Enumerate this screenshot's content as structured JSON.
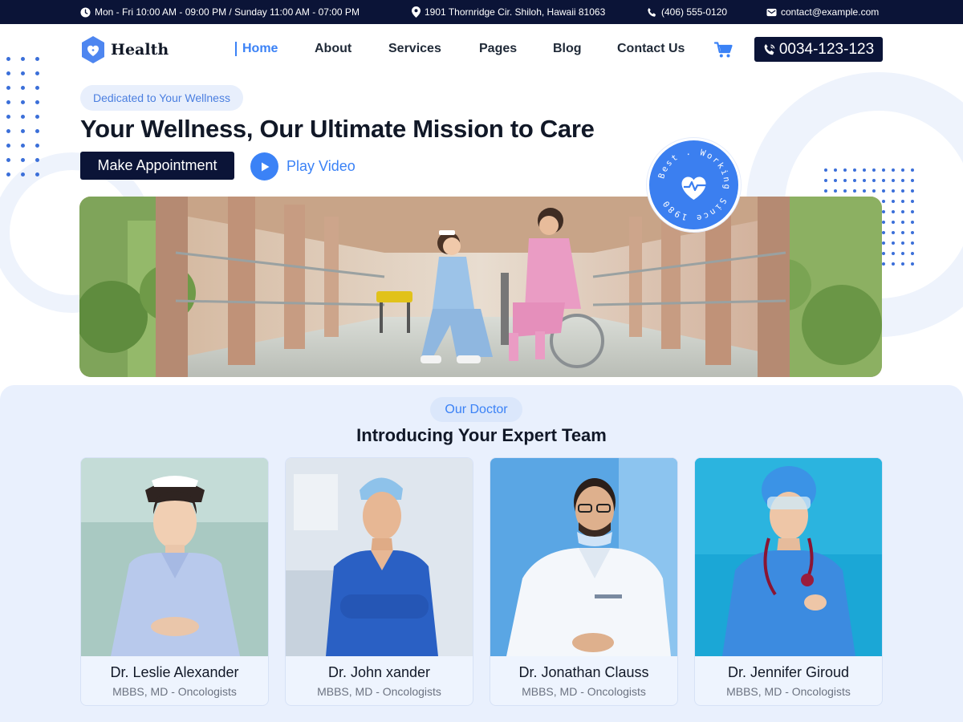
{
  "topbar": {
    "hours": "Mon - Fri 10:00 AM - 09:00 PM / Sunday 11:00 AM - 07:00 PM",
    "address": "1901 Thornridge Cir. Shiloh, Hawaii 81063",
    "phone": "(406) 555-0120",
    "email": "contact@example.com"
  },
  "header": {
    "logo_text": "Health",
    "nav": [
      "Home",
      "About",
      "Services",
      "Pages",
      "Blog",
      "Contact Us"
    ],
    "active_nav": "Home",
    "phone_button": "0034-123-123"
  },
  "hero": {
    "tagline": "Dedicated to Your Wellness",
    "title": "Your Wellness, Our Ultimate Mission to Care",
    "appointment_button": "Make Appointment",
    "play_label": "Play Video",
    "badge_text": "Best . Working Since 1980"
  },
  "doctors": {
    "pill": "Our Doctor",
    "title": "Introducing Your Expert Team",
    "items": [
      {
        "name": "Dr. Leslie Alexander",
        "role": "MBBS, MD - Oncologists"
      },
      {
        "name": "Dr. John xander",
        "role": "MBBS, MD - Oncologists"
      },
      {
        "name": "Dr. Jonathan Clauss",
        "role": "MBBS, MD - Oncologists"
      },
      {
        "name": "Dr. Jennifer Giroud",
        "role": "MBBS, MD - Oncologists"
      }
    ]
  },
  "colors": {
    "navy": "#0b1437",
    "accent": "#3b82f6",
    "section_bg": "#e9f0fd"
  }
}
